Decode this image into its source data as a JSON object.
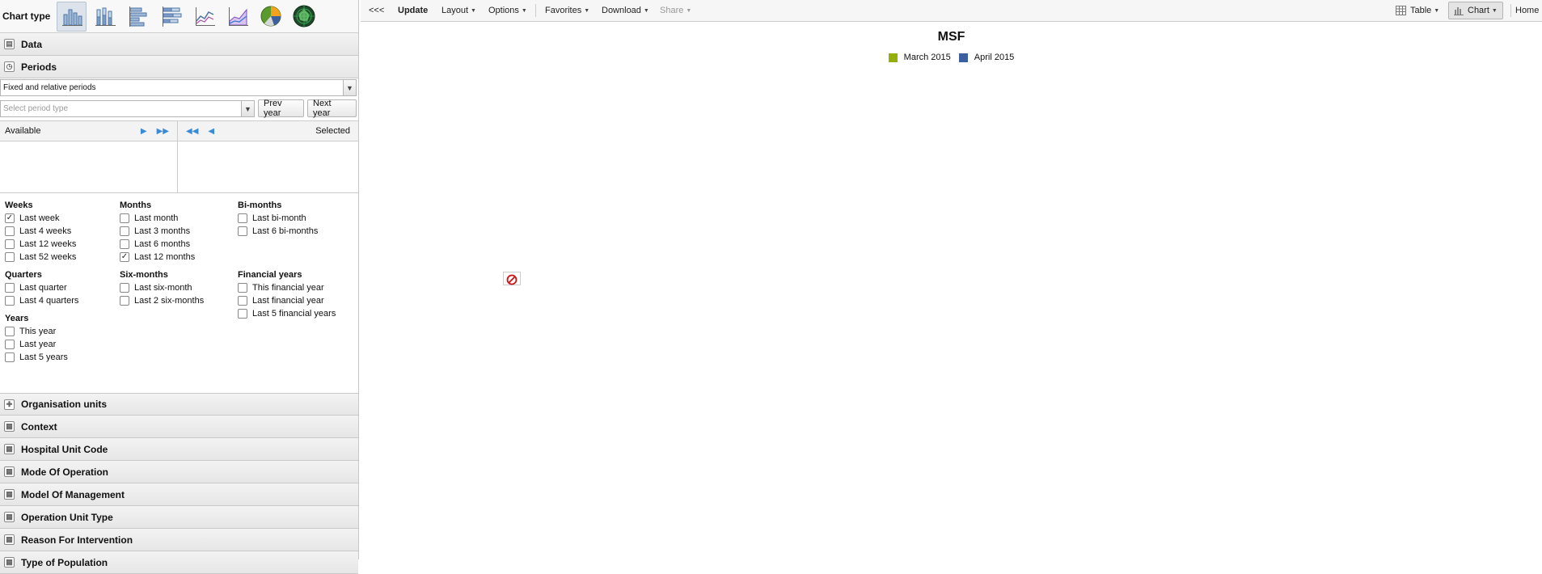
{
  "chart_type": {
    "label": "Chart type",
    "types": [
      {
        "icon": "column-chart-icon"
      },
      {
        "icon": "stacked-column-chart-icon"
      },
      {
        "icon": "bar-chart-icon"
      },
      {
        "icon": "stacked-bar-chart-icon"
      },
      {
        "icon": "line-chart-icon"
      },
      {
        "icon": "area-chart-icon"
      },
      {
        "icon": "pie-chart-icon"
      },
      {
        "icon": "radar-chart-icon"
      }
    ]
  },
  "sections": {
    "data": "Data",
    "periods": "Periods",
    "org_units": "Organisation units",
    "context": "Context",
    "hospital_unit_code": "Hospital Unit Code",
    "mode_of_operation": "Mode Of Operation",
    "model_of_management": "Model Of Management",
    "operation_unit_type": "Operation Unit Type",
    "reason_for_intervention": "Reason For Intervention",
    "type_of_population": "Type of Population"
  },
  "periods": {
    "mode_value": "Fixed and relative periods",
    "period_type_placeholder": "Select period type",
    "prev_year": "Prev year",
    "next_year": "Next year",
    "available": "Available",
    "selected": "Selected",
    "groups": {
      "weeks": {
        "title": "Weeks",
        "items": [
          {
            "label": "Last week",
            "checked": true
          },
          {
            "label": "Last 4 weeks",
            "checked": false
          },
          {
            "label": "Last 12 weeks",
            "checked": false
          },
          {
            "label": "Last 52 weeks",
            "checked": false
          }
        ]
      },
      "months": {
        "title": "Months",
        "items": [
          {
            "label": "Last month",
            "checked": false
          },
          {
            "label": "Last 3 months",
            "checked": false
          },
          {
            "label": "Last 6 months",
            "checked": false
          },
          {
            "label": "Last 12 months",
            "checked": true
          }
        ]
      },
      "bimonths": {
        "title": "Bi-months",
        "items": [
          {
            "label": "Last bi-month",
            "checked": false
          },
          {
            "label": "Last 6 bi-months",
            "checked": false
          }
        ]
      },
      "quarters": {
        "title": "Quarters",
        "items": [
          {
            "label": "Last quarter",
            "checked": false
          },
          {
            "label": "Last 4 quarters",
            "checked": false
          }
        ]
      },
      "sixmonths": {
        "title": "Six-months",
        "items": [
          {
            "label": "Last six-month",
            "checked": false
          },
          {
            "label": "Last 2 six-months",
            "checked": false
          }
        ]
      },
      "financial": {
        "title": "Financial years",
        "items": [
          {
            "label": "This financial year",
            "checked": false
          },
          {
            "label": "Last financial year",
            "checked": false
          },
          {
            "label": "Last 5 financial years",
            "checked": false
          }
        ]
      },
      "years": {
        "title": "Years",
        "items": [
          {
            "label": "This year",
            "checked": false
          },
          {
            "label": "Last year",
            "checked": false
          },
          {
            "label": "Last 5 years",
            "checked": false
          }
        ]
      }
    }
  },
  "toolbar": {
    "collapse": "<<<",
    "update": "Update",
    "layout": "Layout",
    "options": "Options",
    "favorites": "Favorites",
    "download": "Download",
    "share": "Share",
    "table": "Table",
    "chart": "Chart",
    "home": "Home"
  },
  "chart": {
    "title": "MSF",
    "legend": [
      {
        "name": "March 2015",
        "color": "#94ae0a"
      },
      {
        "name": "April 2015",
        "color": "#3d5fa0"
      }
    ],
    "broken_image_icon": "no-entry-icon"
  },
  "colors": {
    "accent": "#3d5fa0",
    "broken": "#cc1111"
  }
}
